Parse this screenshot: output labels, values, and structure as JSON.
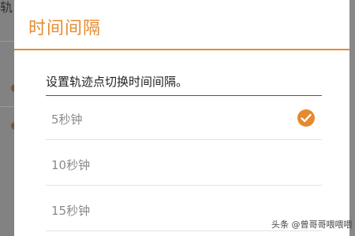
{
  "background": {
    "left_text": "轨"
  },
  "dialog": {
    "title": "时间间隔",
    "message": "设置轨迹点切换时间间隔。",
    "options": [
      {
        "label": "5秒钟",
        "selected": true
      },
      {
        "label": "10秒钟",
        "selected": false
      },
      {
        "label": "15秒钟",
        "selected": false
      }
    ]
  },
  "accent_color": "#e58a2f",
  "icons": {
    "selected": "check-circle-icon"
  },
  "watermark": "头条 @曾哥哥喂喂喂"
}
